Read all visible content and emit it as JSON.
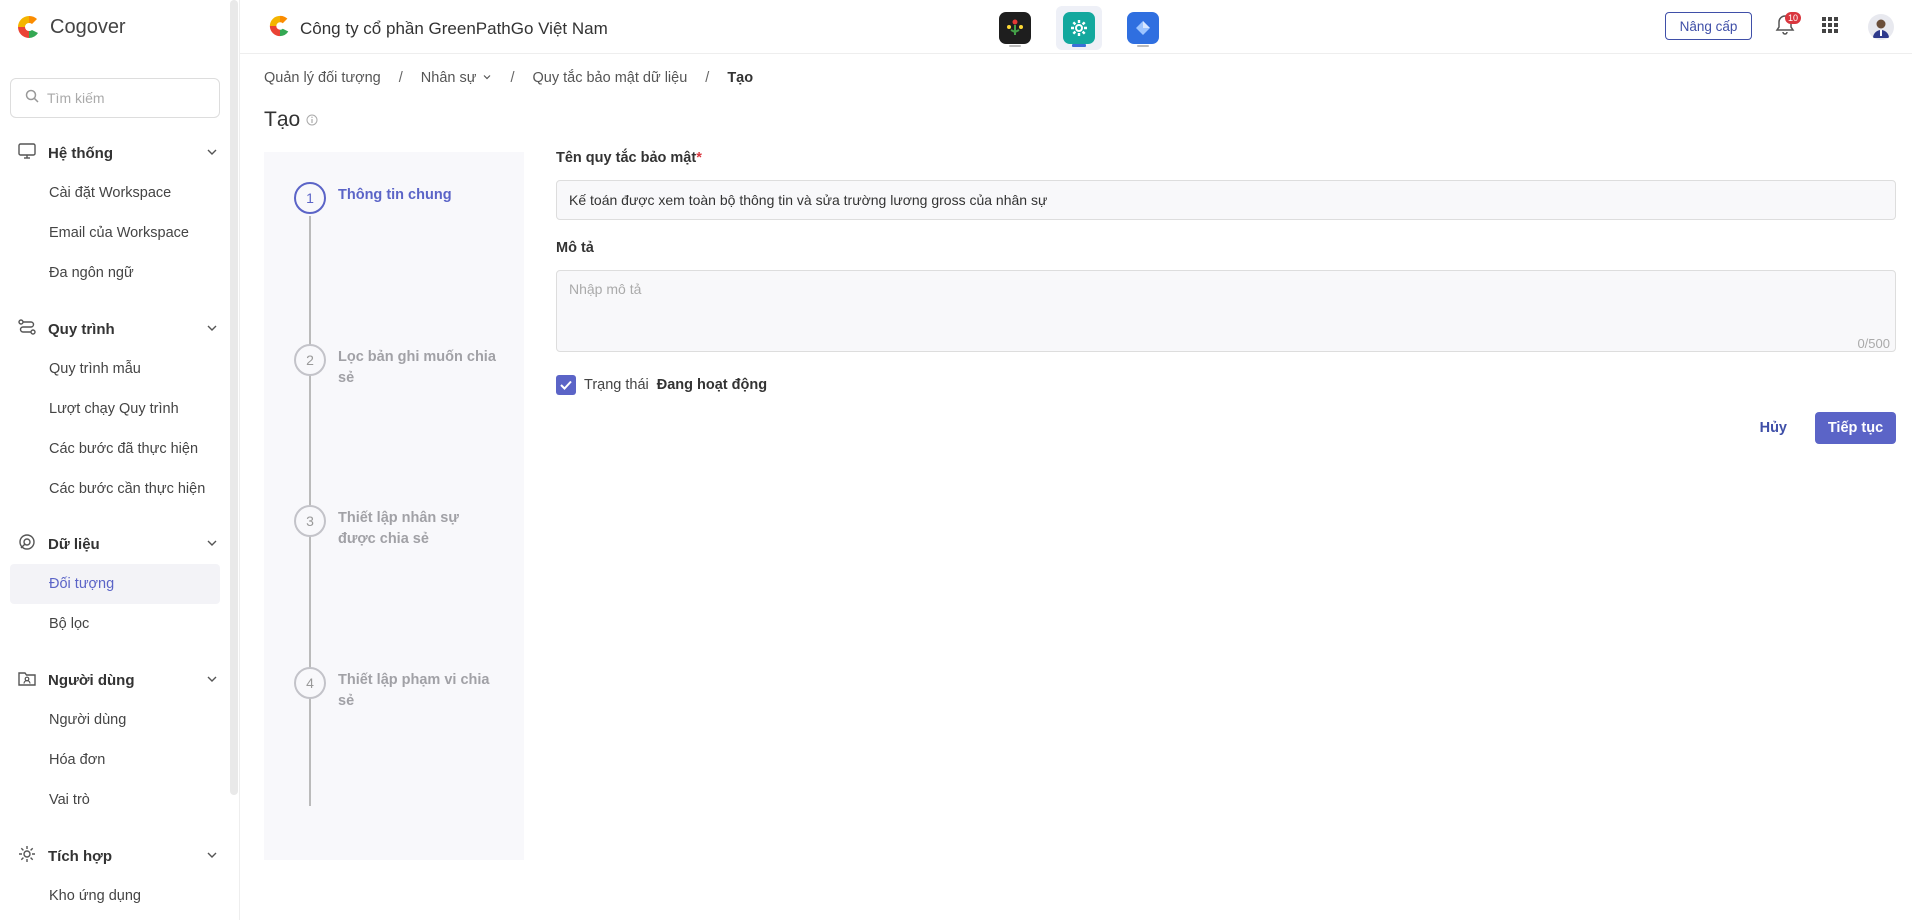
{
  "brand": {
    "name": "Cogover"
  },
  "search": {
    "placeholder": "Tìm kiếm"
  },
  "sidebar": {
    "groups": [
      {
        "label": "Hệ thống",
        "icon": "monitor-icon",
        "items": [
          "Cài đặt Workspace",
          "Email của Workspace",
          "Đa ngôn ngữ"
        ]
      },
      {
        "label": "Quy trình",
        "icon": "workflow-icon",
        "items": [
          "Quy trình mẫu",
          "Lượt chạy Quy trình",
          "Các bước đã thực hiện",
          "Các bước cần thực hiện"
        ]
      },
      {
        "label": "Dữ liệu",
        "icon": "data-icon",
        "items": [
          "Đối tượng",
          "Bộ lọc"
        ]
      },
      {
        "label": "Người dùng",
        "icon": "user-folder-icon",
        "items": [
          "Người dùng",
          "Hóa đơn",
          "Vai trò"
        ]
      },
      {
        "label": "Tích hợp",
        "icon": "integration-gear-icon",
        "items": [
          "Kho ứng dụng"
        ]
      }
    ],
    "active_item": "Đối tượng"
  },
  "topbar": {
    "company": "Công ty cổ phần GreenPathGo Việt Nam",
    "upgrade_label": "Nâng cấp",
    "notification_count": "10",
    "apps": [
      "people-app-icon",
      "settings-app-icon",
      "diamond-app-icon"
    ]
  },
  "breadcrumb": {
    "items": [
      "Quản lý đối tượng",
      "Nhân sự",
      "Quy tắc bảo mật dữ liệu",
      "Tạo"
    ]
  },
  "page": {
    "title": "Tạo"
  },
  "steps": [
    {
      "number": "1",
      "label": "Thông tin chung"
    },
    {
      "number": "2",
      "label": "Lọc bản ghi muốn chia sẻ"
    },
    {
      "number": "3",
      "label": "Thiết lập nhân sự được chia sẻ"
    },
    {
      "number": "4",
      "label": "Thiết lập phạm vi chia sẻ"
    }
  ],
  "form": {
    "name_label": "Tên quy tắc bảo mật",
    "required_mark": "*",
    "name_value": "Kế toán được xem toàn bộ thông tin và sửa trường lương gross của nhân sự",
    "description_label": "Mô tả",
    "description_placeholder": "Nhập mô tả",
    "description_counter": "0/500",
    "status_prefix": "Trạng thái",
    "status_value": "Đang hoạt động",
    "status_checked": true,
    "cancel_label": "Hủy",
    "next_label": "Tiếp tục"
  },
  "colors": {
    "accent": "#5b64c7",
    "accent_dark": "#3f4fa8",
    "badge": "#d9363e"
  }
}
